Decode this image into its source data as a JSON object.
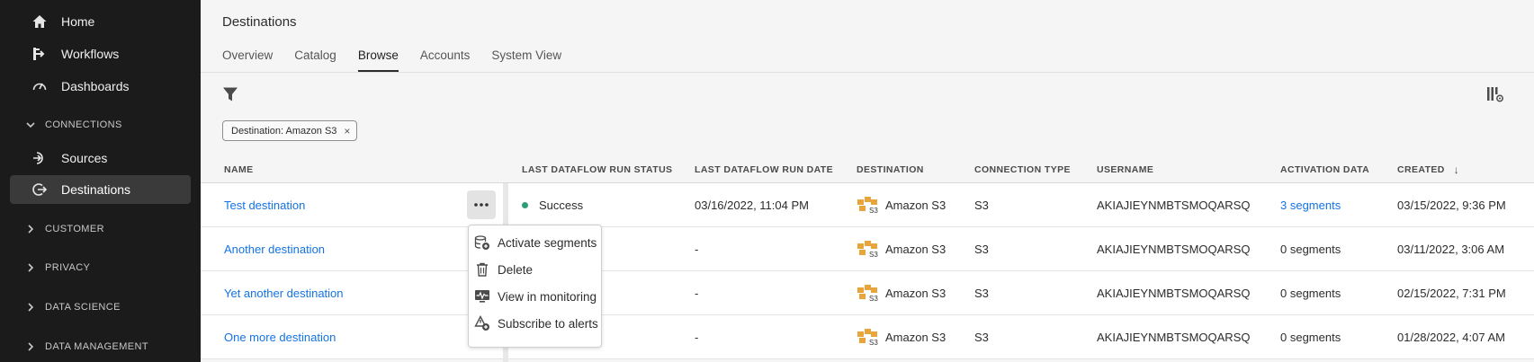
{
  "sidebar": {
    "items": [
      {
        "label": "Home",
        "icon": "home-icon"
      },
      {
        "label": "Workflows",
        "icon": "workflow-icon"
      },
      {
        "label": "Dashboards",
        "icon": "dashboard-icon"
      }
    ],
    "connections": {
      "label": "CONNECTIONS",
      "items": [
        {
          "label": "Sources",
          "icon": "sources-icon"
        },
        {
          "label": "Destinations",
          "icon": "destinations-icon"
        }
      ]
    },
    "sections": [
      "CUSTOMER",
      "PRIVACY",
      "DATA SCIENCE",
      "DATA MANAGEMENT"
    ]
  },
  "header": {
    "title": "Destinations",
    "tabs": [
      "Overview",
      "Catalog",
      "Browse",
      "Accounts",
      "System View"
    ],
    "active_tab": "Browse"
  },
  "filter": {
    "chip_label": "Destination: Amazon S3",
    "chip_close": "×"
  },
  "table": {
    "columns": [
      "NAME",
      "LAST DATAFLOW RUN STATUS",
      "LAST DATAFLOW RUN DATE",
      "DESTINATION",
      "CONNECTION TYPE",
      "USERNAME",
      "ACTIVATION DATA",
      "CREATED"
    ],
    "sort_indicator": "↓",
    "rows": [
      {
        "name": "Test destination",
        "status": "Success",
        "date": "03/16/2022, 11:04 PM",
        "destination": "Amazon S3",
        "type": "S3",
        "username": "AKIAJIEYNMBTSMOQARSQ",
        "activation": "3 segments",
        "created": "03/15/2022, 9:36 PM"
      },
      {
        "name": "Another destination",
        "status": "",
        "date": "-",
        "destination": "Amazon S3",
        "type": "S3",
        "username": "AKIAJIEYNMBTSMOQARSQ",
        "activation": "0 segments",
        "created": "03/11/2022, 3:06 AM"
      },
      {
        "name": "Yet another destination",
        "status": "",
        "date": "-",
        "destination": "Amazon S3",
        "type": "S3",
        "username": "AKIAJIEYNMBTSMOQARSQ",
        "activation": "0 segments",
        "created": "02/15/2022, 7:31 PM"
      },
      {
        "name": "One more destination",
        "status": "",
        "date": "-",
        "destination": "Amazon S3",
        "type": "S3",
        "username": "AKIAJIEYNMBTSMOQARSQ",
        "activation": "0 segments",
        "created": "01/28/2022, 4:07 AM"
      }
    ]
  },
  "menu": {
    "items": [
      {
        "label": "Activate segments",
        "icon": "activate-segments-icon"
      },
      {
        "label": "Delete",
        "icon": "trash-icon"
      },
      {
        "label": "View in monitoring",
        "icon": "monitoring-icon"
      },
      {
        "label": "Subscribe to alerts",
        "icon": "alert-icon"
      }
    ]
  },
  "colors": {
    "sidebar_bg": "#1b1b1b",
    "link": "#1473e6",
    "success": "#2d9d78",
    "s3_orange": "#e8a53b"
  }
}
